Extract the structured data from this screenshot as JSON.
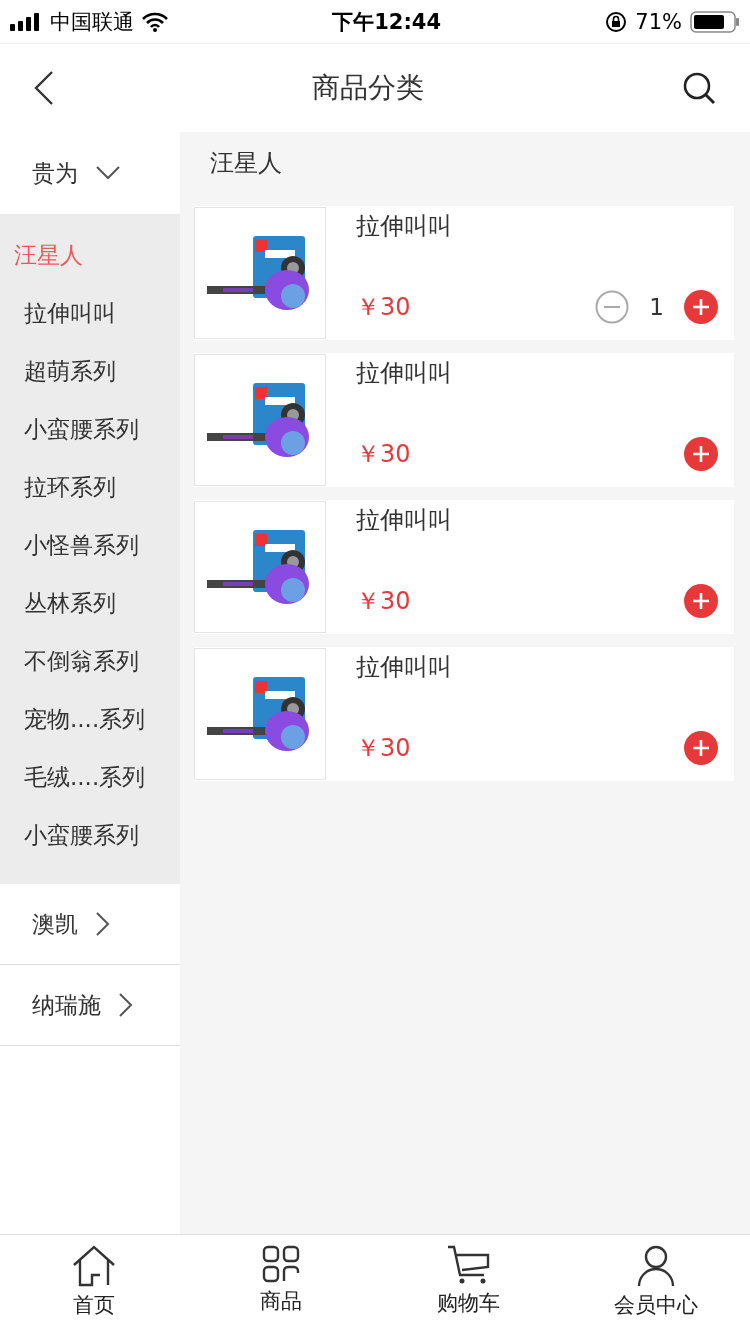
{
  "status_bar": {
    "carrier": "中国联通",
    "time": "下午12:44",
    "battery": "71%"
  },
  "header": {
    "title": "商品分类"
  },
  "sidebar": {
    "brands": [
      {
        "label": "贵为",
        "expanded": true,
        "children": [
          {
            "label": "汪星人",
            "selected": true
          },
          {
            "label": "拉伸叫叫",
            "selected": false
          },
          {
            "label": "超萌系列",
            "selected": false
          },
          {
            "label": "小蛮腰系列",
            "selected": false
          },
          {
            "label": "拉环系列",
            "selected": false
          },
          {
            "label": "小怪兽系列",
            "selected": false
          },
          {
            "label": "丛林系列",
            "selected": false
          },
          {
            "label": "不倒翁系列",
            "selected": false
          },
          {
            "label": "宠物....系列",
            "selected": false
          },
          {
            "label": "毛绒....系列",
            "selected": false
          },
          {
            "label": "小蛮腰系列",
            "selected": false
          }
        ]
      },
      {
        "label": "澳凯",
        "expanded": false
      },
      {
        "label": "纳瑞施",
        "expanded": false
      }
    ]
  },
  "content": {
    "title": "汪星人",
    "products": [
      {
        "name": "拉伸叫叫",
        "price": "￥30",
        "quantity": "1"
      },
      {
        "name": "拉伸叫叫",
        "price": "￥30"
      },
      {
        "name": "拉伸叫叫",
        "price": "￥30"
      },
      {
        "name": "拉伸叫叫",
        "price": "￥30"
      }
    ]
  },
  "tab_bar": [
    {
      "label": "首页",
      "kind": "home",
      "selected": false
    },
    {
      "label": "商品",
      "kind": "grid",
      "selected": false
    },
    {
      "label": "购物车",
      "kind": "cart",
      "selected": false
    },
    {
      "label": "会员中心",
      "kind": "user",
      "selected": false
    }
  ]
}
